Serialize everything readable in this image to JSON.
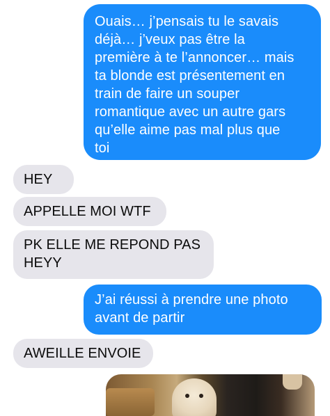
{
  "messages": [
    {
      "direction": "sent",
      "text": "Ouais… j’pensais tu le savais\ndéjà… j’veux pas être la\npremière à te l’annoncer… mais\nta blonde est présentement en\ntrain de faire un souper\nromantique avec un autre gars\nqu’elle aime pas mal plus que\ntoi"
    },
    {
      "direction": "received",
      "text": "HEY"
    },
    {
      "direction": "received",
      "text": "APPELLE MOI WTF"
    },
    {
      "direction": "received",
      "text": "PK ELLE ME REPOND PAS\nHEYY"
    },
    {
      "direction": "sent",
      "text": "J’ai réussi à prendre une photo\navant de partir"
    },
    {
      "direction": "received",
      "text": "AWEILLE ENVOIE"
    }
  ],
  "photo": {
    "direction": "sent"
  },
  "colors": {
    "sent_bubble": "#1a8cfb",
    "received_bubble": "#e6e5eb",
    "background": "#ffffff"
  }
}
